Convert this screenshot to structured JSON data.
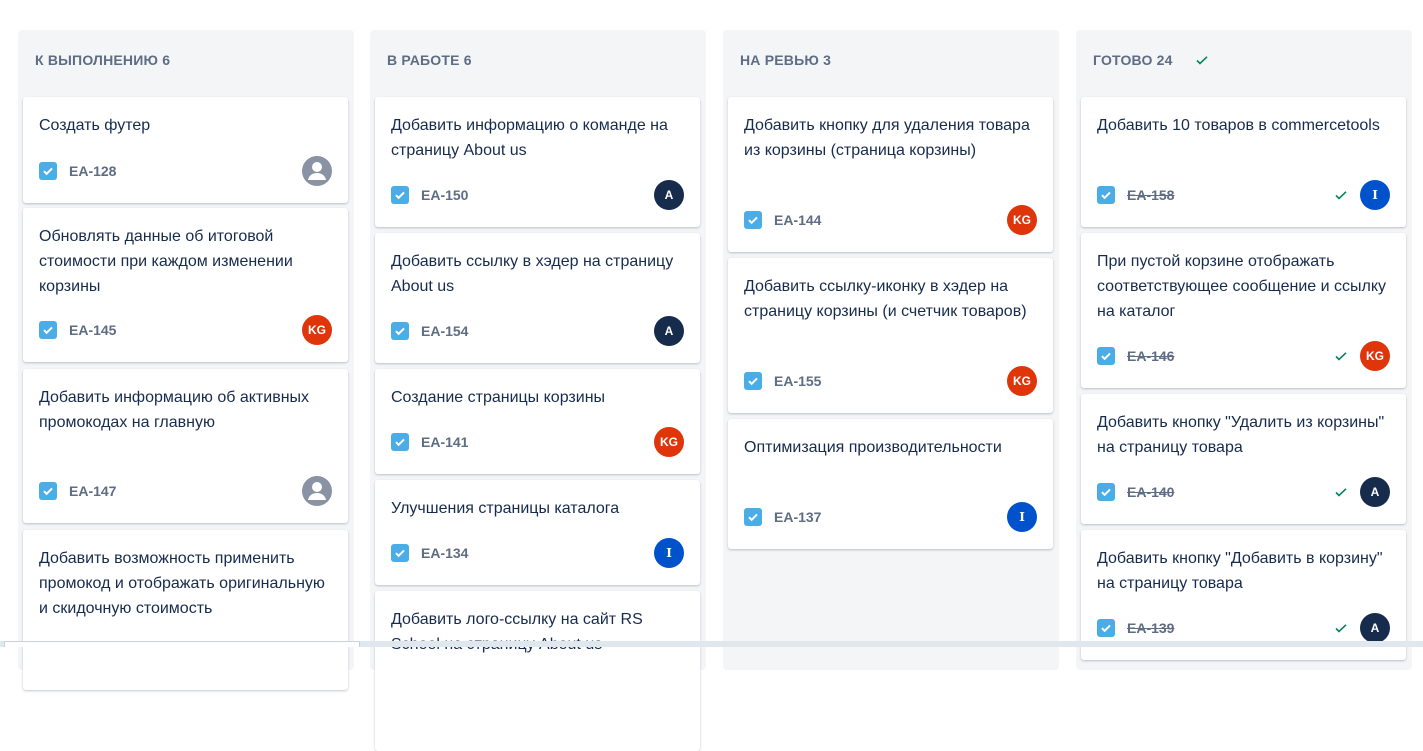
{
  "columns": [
    {
      "title": "К ВЫПОЛНЕНИЮ 6",
      "cards": [
        {
          "title": "Создать футер",
          "key": "EA-128",
          "avatar": ""
        },
        {
          "title": "Обновлять данные об итоговой стоимости при каждом изменении корзины",
          "key": "EA-145",
          "avatar": "KG"
        },
        {
          "title": "Добавить информацию об активных промокодах на главную",
          "key": "EA-147",
          "avatar": ""
        },
        {
          "title": "Добавить возможность применить промокод и отображать оригинальную и скидочную стоимость",
          "key": "",
          "avatar": ""
        }
      ]
    },
    {
      "title": "В РАБОТЕ 6",
      "cards": [
        {
          "title": "Добавить информацию о команде на страницу About us",
          "key": "EA-150",
          "avatar": "A"
        },
        {
          "title": "Добавить ссылку в хэдер на страницу About us",
          "key": "EA-154",
          "avatar": "A"
        },
        {
          "title": "Создание страницы корзины",
          "key": "EA-141",
          "avatar": "KG"
        },
        {
          "title": "Улучшения страницы каталога",
          "key": "EA-134",
          "avatar": "I"
        },
        {
          "title": "Добавить лого-ссылку на сайт RS School на страницу About us",
          "key": "",
          "avatar": ""
        }
      ]
    },
    {
      "title": "НА РЕВЬЮ 3",
      "cards": [
        {
          "title": "Добавить кнопку для удаления товара из корзины (страница корзины)",
          "key": "EA-144",
          "avatar": "KG"
        },
        {
          "title": "Добавить ссылку-иконку в хэдер на страницу корзины (и счетчик товаров)",
          "key": "EA-155",
          "avatar": "KG"
        },
        {
          "title": "Оптимизация производительности",
          "key": "EA-137",
          "avatar": "I"
        }
      ]
    },
    {
      "title": "ГОТОВО 24",
      "cards": [
        {
          "title": "Добавить 10 товаров в commercetools",
          "key": "EA-158",
          "avatar": "I"
        },
        {
          "title": "При пустой корзине отображать соответствующее сообщение и ссылку на каталог",
          "key": "EA-146",
          "avatar": "KG"
        },
        {
          "title": "Добавить кнопку \"Удалить из корзины\" на страницу товара",
          "key": "EA-140",
          "avatar": "A"
        },
        {
          "title": "Добавить кнопку \"Добавить в корзину\" на страницу товара",
          "key": "EA-139",
          "avatar": "A"
        }
      ]
    }
  ],
  "icons": {
    "story_checkbox": "checkbox-icon",
    "resolved": "check-icon",
    "unassigned": "user-icon"
  },
  "colors": {
    "checkbox": "#4bade8",
    "resolved_check": "#00875a",
    "avatar_KG": "#de350b",
    "avatar_A": "#172b4d",
    "avatar_I": "#0052cc",
    "avatar_unassigned": "#8993a4"
  }
}
